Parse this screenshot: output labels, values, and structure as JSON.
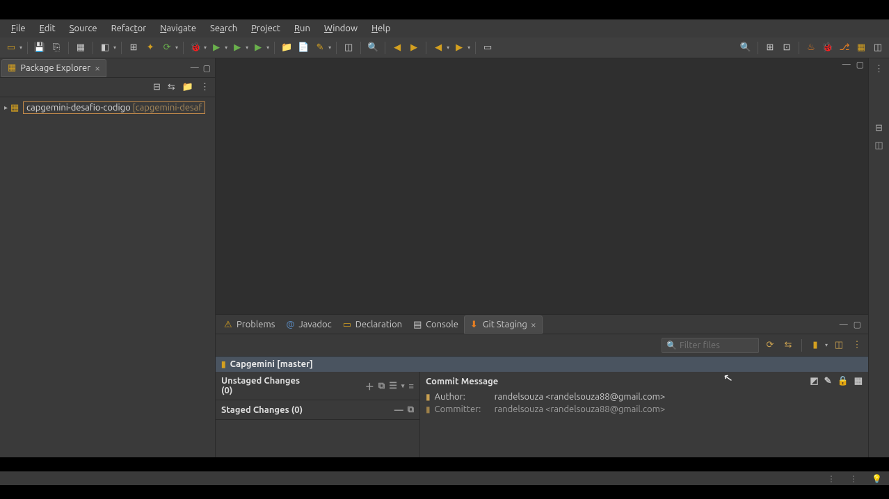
{
  "menu": {
    "file": "File",
    "edit": "Edit",
    "source": "Source",
    "refactor": "Refactor",
    "navigate": "Navigate",
    "search": "Search",
    "project": "Project",
    "run": "Run",
    "window": "Window",
    "help": "Help"
  },
  "views": {
    "package_explorer": "Package Explorer"
  },
  "project": {
    "name": "capgemini-desafio-codigo",
    "repo": "[capgemini-desaf"
  },
  "bottom_tabs": {
    "problems": "Problems",
    "javadoc": "Javadoc",
    "declaration": "Declaration",
    "console": "Console",
    "git_staging": "Git Staging"
  },
  "staging": {
    "filter_placeholder": "Filter files",
    "repo_title": "Capgemini [master]",
    "unstaged": "Unstaged Changes (0)",
    "unstaged_line1": "Unstaged Changes",
    "unstaged_line2": "(0)",
    "staged": "Staged Changes (0)",
    "commit_message": "Commit Message",
    "author_label": "Author:",
    "committer_label": "Committer:",
    "author_value": "randelsouza <randelsouza88@gmail.com>",
    "committer_value": "randelsouza <randelsouza88@gmail.com>"
  }
}
